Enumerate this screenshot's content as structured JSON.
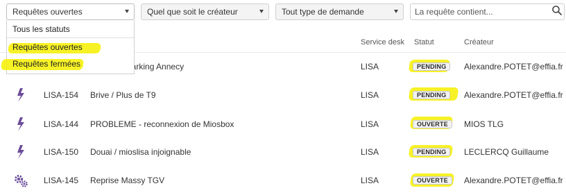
{
  "filters": {
    "status": {
      "selected": "Requêtes ouvertes"
    },
    "creator": {
      "selected": "Quel que soit le créateur"
    },
    "type": {
      "selected": "Tout type de demande"
    },
    "search": {
      "placeholder": "La requête contient..."
    }
  },
  "status_menu": {
    "items": [
      "Tous les statuts",
      "Requêtes ouvertes",
      "Requêtes fermées"
    ]
  },
  "table": {
    "headers": {
      "service_desk": "Service desk",
      "status": "Statut",
      "creator": "Créateur"
    },
    "rows": [
      {
        "icon": "lightning-icon",
        "key": "",
        "summary": "on Parking Annecy",
        "service_desk": "LISA",
        "status": "PENDING",
        "creator": "Alexandre.POTET@effia.fr"
      },
      {
        "icon": "lightning-icon",
        "key": "LISA-154",
        "summary": "Brive / Plus de T9",
        "service_desk": "LISA",
        "status": "PENDING",
        "creator": "Alexandre.POTET@effia.fr"
      },
      {
        "icon": "lightning-icon",
        "key": "LISA-144",
        "summary": "PROBLEME - reconnexion de Miosbox",
        "service_desk": "LISA",
        "status": "OUVERTE",
        "creator": "MIOS TLG"
      },
      {
        "icon": "lightning-icon",
        "key": "LISA-150",
        "summary": "Douai / mioslisa injoignable",
        "service_desk": "LISA",
        "status": "PENDING",
        "creator": "LECLERCQ Guillaume"
      },
      {
        "icon": "gears-icon",
        "key": "LISA-145",
        "summary": "Reprise Massy TGV",
        "service_desk": "LISA",
        "status": "OUVERTE",
        "creator": "Alexandre.POTET@effia.fr"
      }
    ]
  },
  "colors": {
    "icon_purple": "#6b4c9a",
    "highlight": "#f6f000"
  }
}
